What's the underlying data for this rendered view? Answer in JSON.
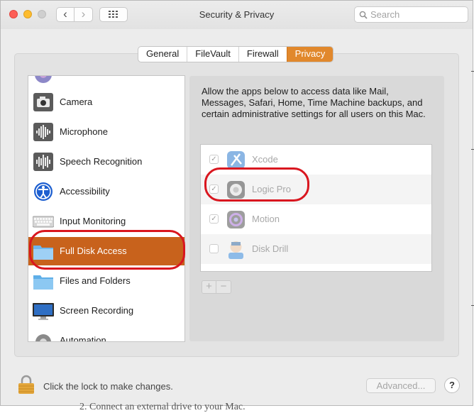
{
  "window": {
    "title": "Security & Privacy"
  },
  "toolbar": {
    "back_icon": "chevron-left-icon",
    "forward_icon": "chevron-right-icon",
    "grid_icon": "show-all-grid-icon",
    "search_placeholder": "Search"
  },
  "tabs": [
    {
      "label": "General",
      "active": false
    },
    {
      "label": "FileVault",
      "active": false
    },
    {
      "label": "Firewall",
      "active": false
    },
    {
      "label": "Privacy",
      "active": true
    }
  ],
  "sidebar": {
    "items": [
      {
        "label": "Camera",
        "icon": "camera-icon",
        "selected": false
      },
      {
        "label": "Microphone",
        "icon": "microphone-icon",
        "selected": false
      },
      {
        "label": "Speech Recognition",
        "icon": "speech-recognition-icon",
        "selected": false
      },
      {
        "label": "Accessibility",
        "icon": "accessibility-icon",
        "selected": false
      },
      {
        "label": "Input Monitoring",
        "icon": "keyboard-icon",
        "selected": false
      },
      {
        "label": "Full Disk Access",
        "icon": "folder-icon",
        "selected": true
      },
      {
        "label": "Files and Folders",
        "icon": "folder-icon",
        "selected": false
      },
      {
        "label": "Screen Recording",
        "icon": "display-icon",
        "selected": false
      },
      {
        "label": "Automation",
        "icon": "gear-icon",
        "selected": false
      }
    ]
  },
  "main": {
    "description": "Allow the apps below to access data like Mail, Messages, Safari, Home, Time Machine backups, and certain administrative settings for all users on this Mac.",
    "apps": [
      {
        "name": "Xcode",
        "checked": true,
        "icon": "xcode-icon"
      },
      {
        "name": "Logic Pro",
        "checked": true,
        "icon": "logic-pro-icon"
      },
      {
        "name": "Motion",
        "checked": true,
        "icon": "motion-icon"
      },
      {
        "name": "Disk Drill",
        "checked": false,
        "icon": "disk-drill-icon"
      }
    ],
    "add_label": "+",
    "remove_label": "−"
  },
  "footer": {
    "lock_text": "Click the lock to make changes.",
    "advanced_label": "Advanced...",
    "help_label": "?"
  },
  "background_text": "2. Connect an external drive to your Mac."
}
